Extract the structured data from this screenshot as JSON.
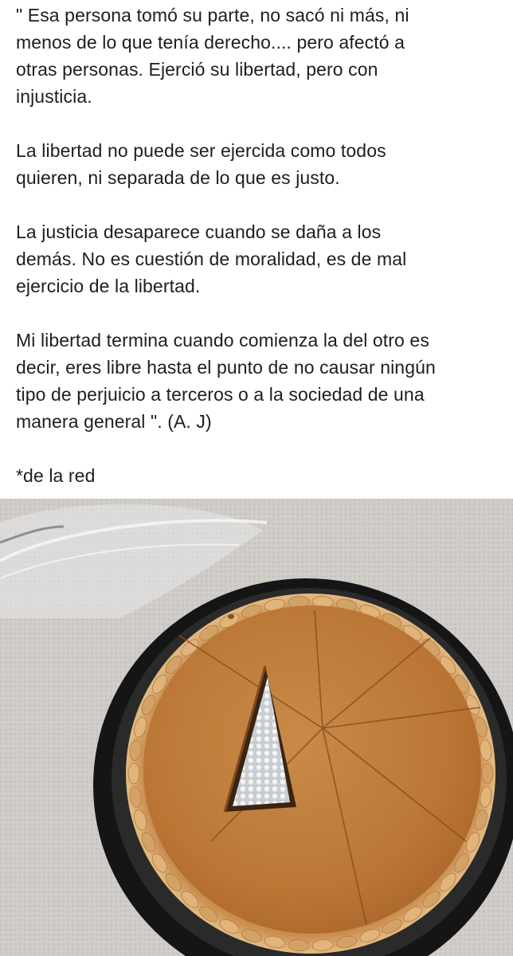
{
  "post": {
    "paragraphs": [
      {
        "lines": [
          "\" Esa persona tomó su parte, no sacó ni más, ni",
          "menos de lo que tenía derecho.... pero afectó a",
          "otras personas. Ejerció su libertad, pero con",
          "injusticia."
        ]
      },
      {
        "lines": [
          "La libertad no puede ser ejercida como todos",
          "quieren, ni separada de lo que es justo."
        ]
      },
      {
        "lines": [
          "La justicia desaparece cuando se daña a los",
          "demás. No es cuestión de moralidad, es de mal",
          "ejercicio de la libertad."
        ]
      },
      {
        "lines": [
          "Mi libertad termina cuando comienza la del otro es",
          "decir, eres libre hasta el punto de no causar ningún",
          "tipo de perjuicio a terceros o a la sociedad de una",
          "manera general \". (A. J)"
        ]
      },
      {
        "lines": [
          "*de la red"
        ]
      }
    ]
  },
  "photo": {
    "subject": "pumpkin-pie-with-one-slice-removed",
    "colors": {
      "background": "#cfccc8",
      "tray": "#141414",
      "crust": "#d9a86a",
      "filling": "#bf7a38",
      "foil": "#d8dadd"
    }
  }
}
